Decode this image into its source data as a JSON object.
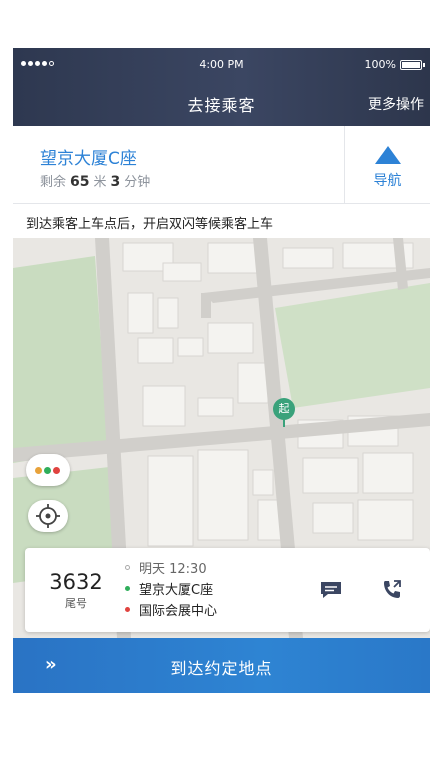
{
  "status_bar": {
    "time": "4:00 PM",
    "battery": "100%"
  },
  "header": {
    "title": "去接乘客",
    "more": "更多操作"
  },
  "destination": {
    "name": "望京大厦C座",
    "remain_prefix": "剩余",
    "distance_value": "65",
    "distance_unit": "米",
    "duration_value": "3",
    "duration_unit": "分钟",
    "nav_label": "导航"
  },
  "notice": "到达乘客上车点后，开启双闪等候乘客上车",
  "map": {
    "pin_label": "起",
    "accent": "#3aa27b"
  },
  "order": {
    "tail_number": "3632",
    "tail_label": "尾号",
    "time": "明天 12:30",
    "pickup": "望京大厦C座",
    "dropoff": "国际会展中心",
    "pickup_color": "#2fae5b",
    "dropoff_color": "#e0433f"
  },
  "arrive_button": {
    "icon": "»",
    "label": "到达约定地点"
  },
  "colors": {
    "primary": "#2d82d6",
    "nav_bg": "#343f58"
  }
}
